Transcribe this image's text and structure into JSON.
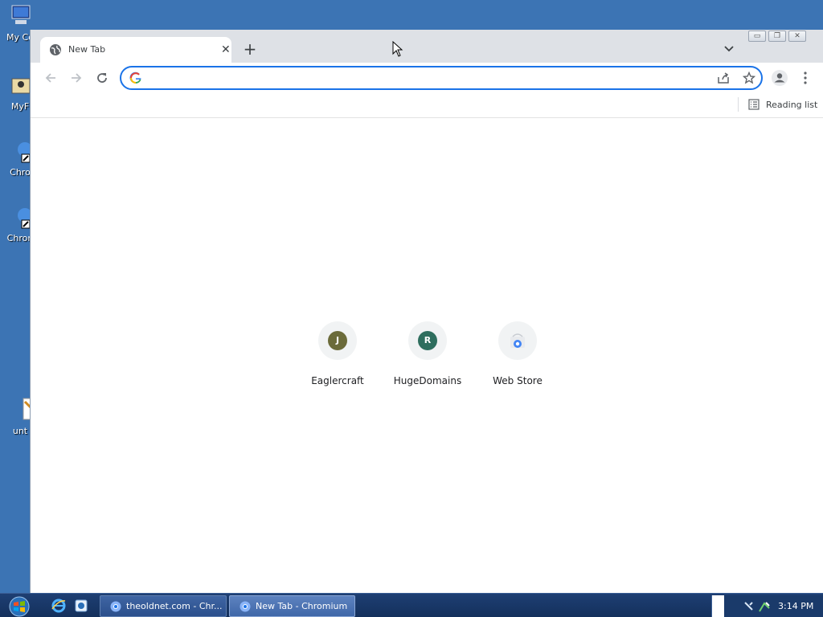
{
  "desktop": {
    "icons": [
      {
        "label": "My Co"
      },
      {
        "label": "MyF"
      },
      {
        "label": "Chro"
      },
      {
        "label": "Chron"
      },
      {
        "label": "unt"
      }
    ]
  },
  "browser": {
    "tab": {
      "title": "New Tab"
    },
    "window_controls": {
      "minimize": "▭",
      "restore": "❐",
      "close": "✕"
    },
    "omnibox": {
      "value": "",
      "placeholder": ""
    },
    "bookmarks_bar": {
      "reading_list_label": "Reading list"
    },
    "shortcuts": [
      {
        "label": "Eaglercraft",
        "letter": "J",
        "color": "#6b6b3a"
      },
      {
        "label": "HugeDomains",
        "letter": "R",
        "color": "#2e6e5e"
      },
      {
        "label": "Web Store",
        "letter": "",
        "color": "#4285f4"
      }
    ]
  },
  "taskbar": {
    "tasks": [
      {
        "label": "theoldnet.com - Chr..."
      },
      {
        "label": "New Tab - Chromium"
      }
    ],
    "clock": "3:14 PM"
  },
  "colors": {
    "accent": "#1a73e8",
    "desktop": "#3c74b4",
    "taskbar": "#1e3f73"
  }
}
